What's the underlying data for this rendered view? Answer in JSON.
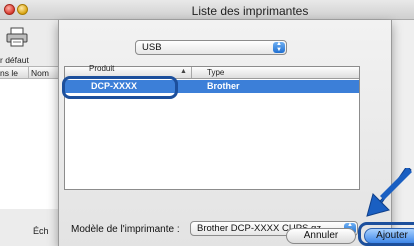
{
  "window": {
    "title": "Liste des imprimantes"
  },
  "background": {
    "toolbar_label": "r défaut",
    "list_header": {
      "col1": "ns le",
      "col2": "Nom"
    },
    "bottom_label": "Éch"
  },
  "connection_popup": {
    "value": "USB"
  },
  "printer_table": {
    "headers": {
      "name": "Produit",
      "type": "Type"
    },
    "rows": [
      {
        "name": "DCP-XXXX",
        "type": "Brother"
      }
    ]
  },
  "model_popup": {
    "label": "Modèle de l'imprimante :",
    "value": "Brother DCP-XXXX CUPS.gz"
  },
  "buttons": {
    "cancel": "Annuler",
    "add": "Ajouter"
  },
  "colors": {
    "selection": "#3c7fd8",
    "highlight_ring": "#1c4f9c",
    "arrow": "#1a5fc2"
  }
}
